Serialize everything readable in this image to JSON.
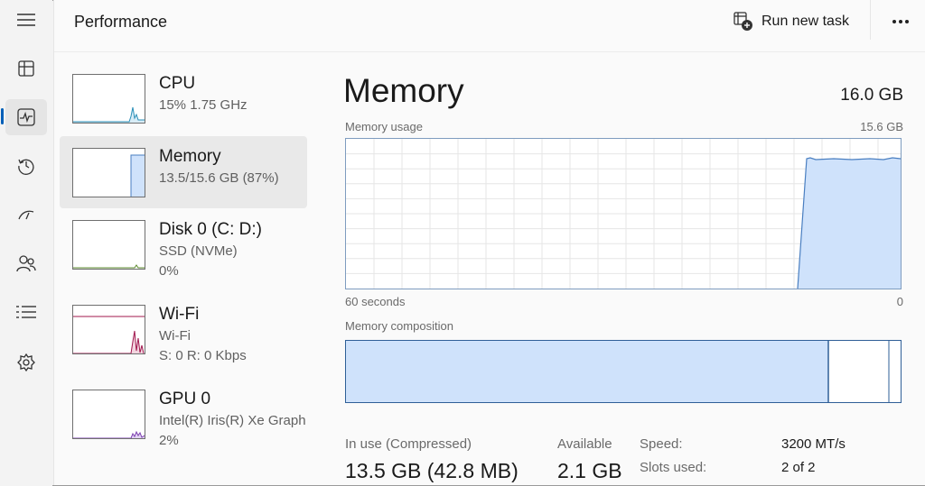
{
  "header": {
    "title": "Performance",
    "run_new_task": "Run new task"
  },
  "nav": {
    "items": [
      {
        "icon": "hamburger-menu-icon"
      },
      {
        "icon": "processes-icon"
      },
      {
        "icon": "performance-icon",
        "active": true
      },
      {
        "icon": "app-history-icon"
      },
      {
        "icon": "startup-apps-icon"
      },
      {
        "icon": "users-icon"
      },
      {
        "icon": "details-icon"
      },
      {
        "icon": "services-icon"
      }
    ]
  },
  "devices": [
    {
      "name": "CPU",
      "line1": "15%  1.75 GHz",
      "line2": ""
    },
    {
      "name": "Memory",
      "line1": "13.5/15.6 GB (87%)",
      "line2": "",
      "active": true
    },
    {
      "name": "Disk 0 (C: D:)",
      "line1": "SSD (NVMe)",
      "line2": "0%"
    },
    {
      "name": "Wi-Fi",
      "line1": "Wi-Fi",
      "line2": "S: 0 R: 0 Kbps"
    },
    {
      "name": "GPU 0",
      "line1": "Intel(R) Iris(R) Xe Graph",
      "line2": "2%"
    }
  ],
  "detail": {
    "title": "Memory",
    "total": "16.0 GB",
    "usage_label": "Memory usage",
    "usage_max": "15.6 GB",
    "time_left": "60 seconds",
    "time_right": "0",
    "composition_label": "Memory composition",
    "in_use_label": "In use (Compressed)",
    "in_use_value": "13.5 GB (42.8 MB)",
    "available_label": "Available",
    "available_value": "2.1 GB",
    "speed_label": "Speed:",
    "speed_value": "3200 MT/s",
    "slots_label": "Slots used:",
    "slots_value": "2 of 2"
  },
  "colors": {
    "memory_fill": "#cfe2fb",
    "memory_line": "#4a7fc1",
    "cpu_line": "#2a8fb8",
    "wifi_line": "#a0174e",
    "disk_line": "#5b8a2c",
    "gpu_line": "#7b3fb0",
    "accent": "#005fb8"
  }
}
